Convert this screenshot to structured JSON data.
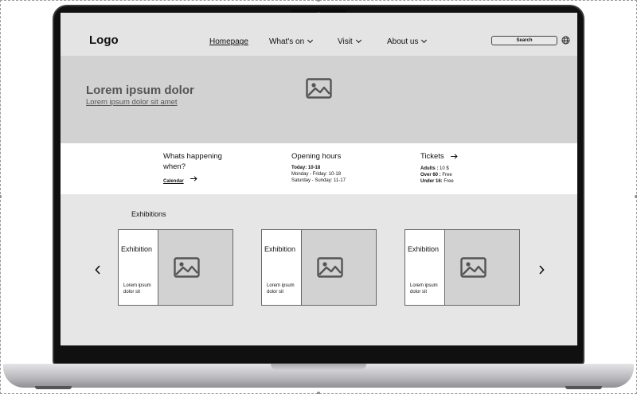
{
  "nav": {
    "logo": "Logo",
    "items": [
      {
        "label": "Homepage",
        "active": true,
        "dropdown": false
      },
      {
        "label": "What's on",
        "dropdown": true
      },
      {
        "label": "Visit",
        "dropdown": true
      },
      {
        "label": "About us",
        "dropdown": true
      }
    ],
    "search_label": "Search",
    "globe_icon": "globe-icon"
  },
  "hero": {
    "title": "Lorem ipsum dolor",
    "link": "Lorem ipsum dolor sit amet",
    "image_icon": "image-placeholder-icon"
  },
  "info": {
    "happening": {
      "title_line1": "Whats happening",
      "title_line2": "when?",
      "link": "Calendar"
    },
    "hours": {
      "title": "Opening hours",
      "lines": [
        "Today: 10-18",
        "Monday - Friday: 10-18",
        "Saturday - Sunday: 11-17"
      ]
    },
    "tickets": {
      "title": "Tickets",
      "prices": [
        {
          "label": "Adults :",
          "value": "10 $"
        },
        {
          "label": "Over 60 :",
          "value": "Free"
        },
        {
          "label": "Under 16:",
          "value": "Free"
        }
      ]
    }
  },
  "exhibitions": {
    "title": "Exhibitions",
    "cards": [
      {
        "title": "Exhibition",
        "description": "Lorem ipsum dolor sit"
      },
      {
        "title": "Exhibition",
        "description": "Lorem ipsum dolor sit"
      },
      {
        "title": "Exhibition",
        "description": "Lorem ipsum dolor sit"
      }
    ]
  },
  "colors": {
    "page_bg": "#e6e6e6",
    "hero_bg": "#d2d2d2",
    "info_bg": "#ffffff",
    "text": "#111111",
    "muted": "#555555"
  }
}
